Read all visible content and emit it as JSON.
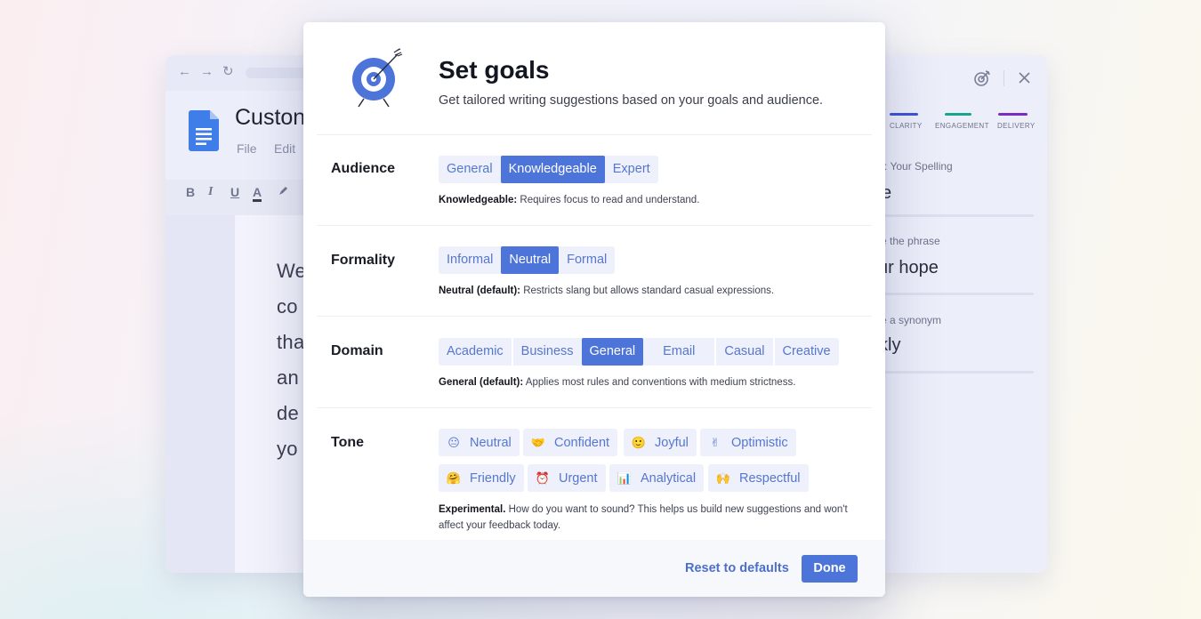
{
  "doc": {
    "title": "Custon",
    "menu": [
      "File",
      "Edit"
    ],
    "format_icons": [
      "bold-icon",
      "italic-icon",
      "underline-icon",
      "text-color-icon",
      "highlight-icon"
    ],
    "lines": [
      "We",
      "co",
      "tha",
      "an",
      "de",
      "yo"
    ]
  },
  "assistant": {
    "metrics": [
      {
        "label": "CLARITY",
        "color": "#3b52d4"
      },
      {
        "label": "ENGAGEMENT",
        "color": "#17a58f"
      },
      {
        "label": "DELIVERY",
        "color": "#7a2bc4"
      }
    ],
    "cards": [
      {
        "small": ": Your Spelling",
        "big": "e"
      },
      {
        "small": "e the phrase",
        "big": "ur hope"
      },
      {
        "small": "e a synonym",
        "big": "kly"
      }
    ]
  },
  "modal": {
    "title": "Set goals",
    "subtitle": "Get tailored writing suggestions based on your goals and audience.",
    "audience": {
      "label": "Audience",
      "options": [
        "General",
        "Knowledgeable",
        "Expert"
      ],
      "selected": "Knowledgeable",
      "desc_bold": "Knowledgeable:",
      "desc_text": " Requires focus to read and understand."
    },
    "formality": {
      "label": "Formality",
      "options": [
        "Informal",
        "Neutral",
        "Formal"
      ],
      "selected": "Neutral",
      "desc_bold": "Neutral (default):",
      "desc_text": " Restricts slang but allows standard casual expressions."
    },
    "domain": {
      "label": "Domain",
      "options": [
        "Academic",
        "Business",
        "General",
        "Email",
        "Casual",
        "Creative"
      ],
      "selected": "General",
      "desc_bold": "General (default):",
      "desc_text": " Applies most rules and conventions with medium strictness."
    },
    "tone": {
      "label": "Tone",
      "chips": [
        {
          "emoji": "😐",
          "label": "Neutral"
        },
        {
          "emoji": "🤝",
          "label": "Confident"
        },
        {
          "emoji": "🙂",
          "label": "Joyful"
        },
        {
          "emoji": "✌",
          "label": "Optimistic"
        },
        {
          "emoji": "🤗",
          "label": "Friendly"
        },
        {
          "emoji": "⏰",
          "label": "Urgent"
        },
        {
          "emoji": "📊",
          "label": "Analytical"
        },
        {
          "emoji": "🙌",
          "label": "Respectful"
        }
      ],
      "desc_bold": "Experimental.",
      "desc_text": " How do you want to sound? This helps us build new suggestions and won't affect your feedback today."
    },
    "footer": {
      "reset_label": "Reset to defaults",
      "done_label": "Done"
    }
  }
}
